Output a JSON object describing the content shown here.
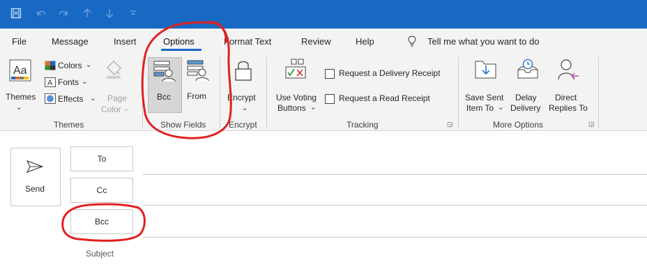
{
  "quick_access": {
    "icons": [
      "save-icon",
      "undo-icon",
      "redo-icon",
      "up-arrow-icon",
      "down-arrow-icon",
      "customize-icon"
    ]
  },
  "tabs": [
    {
      "label": "File"
    },
    {
      "label": "Message"
    },
    {
      "label": "Insert"
    },
    {
      "label": "Options"
    },
    {
      "label": "Format Text"
    },
    {
      "label": "Review"
    },
    {
      "label": "Help"
    }
  ],
  "tell_me": "Tell me what you want to do",
  "active_tab": "Options",
  "ribbon": {
    "themes": {
      "themes_label": "Themes",
      "colors_label": "Colors",
      "fonts_label": "Fonts",
      "effects_label": "Effects",
      "page_label": "Page",
      "color_label": "Color",
      "group": "Themes"
    },
    "show_fields": {
      "bcc_label": "Bcc",
      "from_label": "From",
      "group": "Show Fields"
    },
    "encrypt": {
      "encrypt_label": "Encrypt",
      "group": "Encrypt"
    },
    "tracking": {
      "voting_line1": "Use Voting",
      "voting_line2": "Buttons",
      "delivery_receipt": "Request a Delivery Receipt",
      "read_receipt": "Request a Read Receipt",
      "group": "Tracking"
    },
    "more_options": {
      "save_sent_line1": "Save Sent",
      "save_sent_line2": "Item To",
      "delay_line1": "Delay",
      "delay_line2": "Delivery",
      "direct_line1": "Direct",
      "direct_line2": "Replies To",
      "group": "More Options"
    }
  },
  "compose": {
    "send_label": "Send",
    "to_label": "To",
    "cc_label": "Cc",
    "bcc_label": "Bcc",
    "subject_label": "Subject"
  },
  "colors": {
    "accent": "#1769c4",
    "annotation": "#e02020"
  }
}
